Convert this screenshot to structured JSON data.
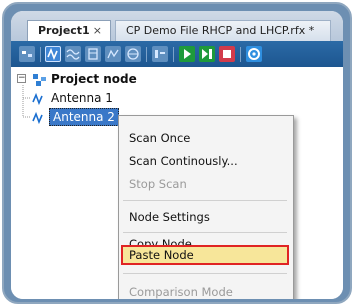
{
  "tabs": [
    {
      "label": "Project1",
      "close": "×"
    },
    {
      "label": "CP Demo File RHCP and LHCP.rfx *"
    }
  ],
  "toolbar": {
    "buttons": [
      "select-icon",
      "antenna-icon",
      "wave-icon",
      "table-icon",
      "chart-icon",
      "sphere-icon",
      "scan-list-icon",
      "play-icon",
      "play-next-icon",
      "stop-icon",
      "settings-icon"
    ]
  },
  "tree": {
    "root": {
      "label": "Project node",
      "expander": "−"
    },
    "children": [
      {
        "label": "Antenna 1"
      },
      {
        "label": "Antenna 2",
        "selected": true
      }
    ]
  },
  "context_menu": {
    "items": [
      {
        "label": "Scan Once",
        "enabled": true
      },
      {
        "label": "Scan Continously...",
        "enabled": true
      },
      {
        "label": "Stop Scan",
        "enabled": false
      },
      {
        "label": "Node Settings",
        "enabled": true
      },
      {
        "label": "Copy Node",
        "enabled": true
      },
      {
        "label": "Paste Node",
        "enabled": true,
        "highlighted": true
      },
      {
        "label": "Comparison Mode",
        "enabled": false
      }
    ]
  },
  "colors": {
    "toolbar": "#1d5690",
    "highlight_border": "#e02424",
    "highlight_fill": "#f7e69a",
    "selection": "#3a78c8"
  }
}
